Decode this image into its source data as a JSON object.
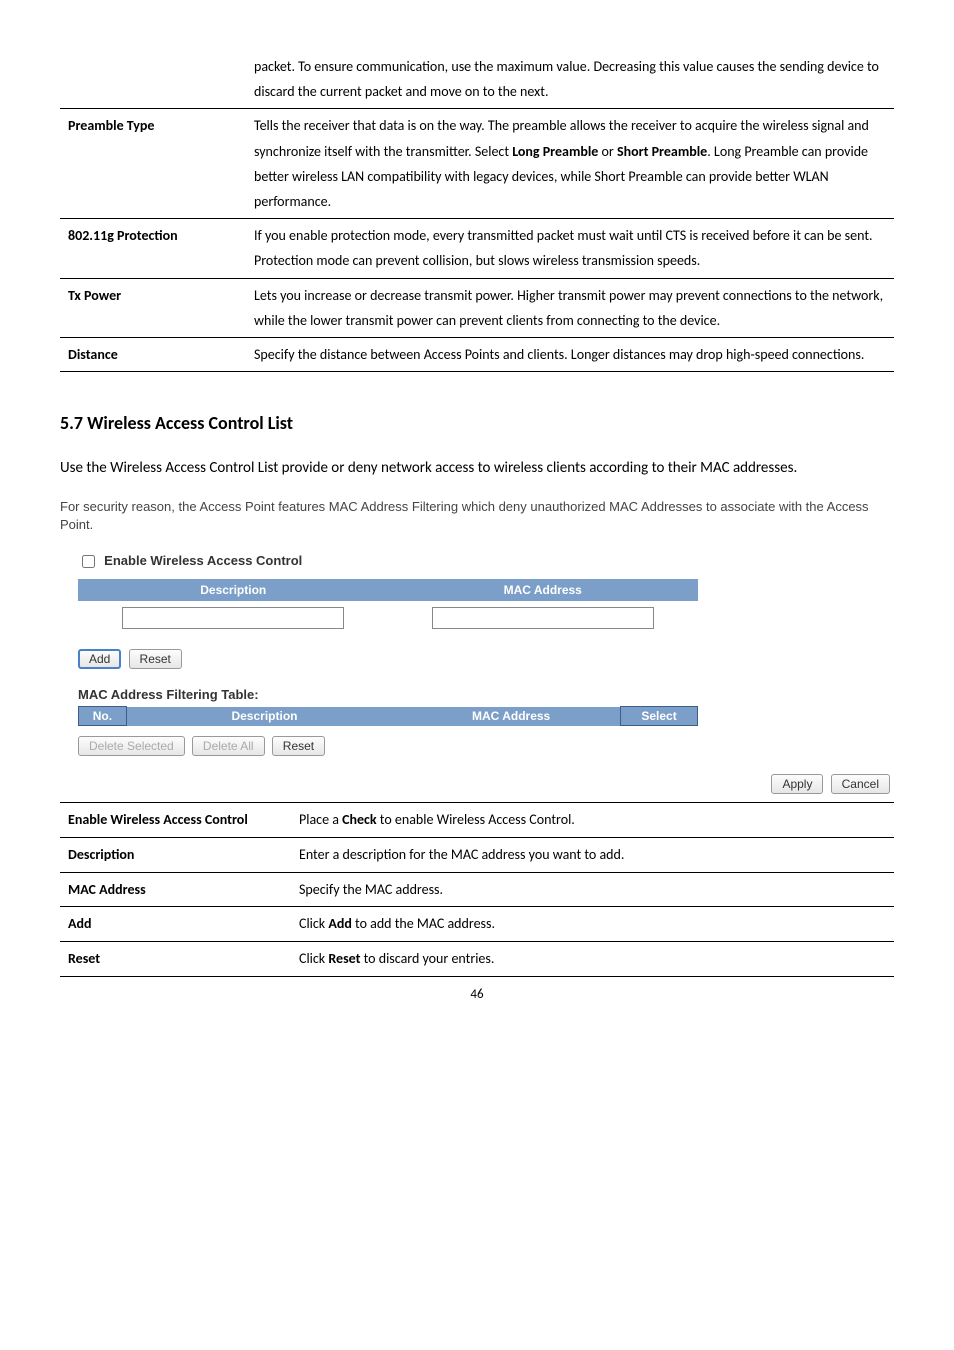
{
  "rows": [
    {
      "label": "",
      "desc": [
        "packet. To ensure communication, use the maximum value. Decreasing this value causes the sending device to discard the current packet and move on to the next."
      ]
    },
    {
      "label": "Preamble Type",
      "desc": [
        "Tells the receiver that data is on the way. The preamble allows the receiver to acquire the wireless signal and synchronize itself with the transmitter. Select ",
        {
          "b": "Long Preamble"
        },
        " or ",
        {
          "b": "Short Preamble"
        },
        ". Long Preamble can provide better wireless LAN compatibility with legacy devices, while Short Preamble can provide better WLAN performance."
      ]
    },
    {
      "label": "802.11g Protection",
      "desc": [
        "If you enable protection mode, every transmitted packet must wait until CTS is received before it can be sent. Protection mode can prevent collision, but slows wireless transmission speeds."
      ]
    },
    {
      "label": "Tx Power",
      "desc": [
        "Lets you increase or decrease transmit power. Higher transmit power may prevent connections to the network, while the lower transmit power can prevent clients from connecting to the device."
      ]
    },
    {
      "label": "Distance",
      "desc": [
        "Specify the distance between Access Points and clients. Longer distances may drop high-speed connections."
      ]
    }
  ],
  "section_heading": "5.7 Wireless Access Control List",
  "intro": "Use the Wireless Access Control List provide or deny network access to wireless clients according to their MAC addresses.",
  "sub": "For security reason, the Access Point features MAC Address Filtering which deny unauthorized MAC Addresses to associate with the Access Point.",
  "wac_title": "Enable Wireless Access Control",
  "table1_headers": {
    "desc": "Description",
    "mac": "MAC Address"
  },
  "btn_add": "Add",
  "btn_reset": "Reset",
  "filtering_title": "MAC Address Filtering Table:",
  "table2_headers": {
    "no": "No.",
    "desc": "Description",
    "mac": "MAC Address",
    "sel": "Select"
  },
  "btn_delete_selected": "Delete Selected",
  "btn_delete_all": "Delete All",
  "btn_reset2": "Reset",
  "btn_apply": "Apply",
  "btn_cancel": "Cancel",
  "defs2": [
    {
      "label": "Enable Wireless Access Control",
      "desc": [
        "Place a ",
        {
          "b": "Check"
        },
        " to enable Wireless Access Control."
      ]
    },
    {
      "label": "Description",
      "desc": [
        "Enter a description for the MAC address you want to add."
      ]
    },
    {
      "label": "MAC Address",
      "desc": [
        "Specify the MAC address."
      ]
    },
    {
      "label": "Add",
      "desc": [
        "Click ",
        {
          "b": "Add"
        },
        " to add the MAC address."
      ]
    },
    {
      "label": "Reset",
      "desc": [
        "Click ",
        {
          "b": "Reset"
        },
        " to discard your entries."
      ]
    }
  ],
  "page": "46"
}
